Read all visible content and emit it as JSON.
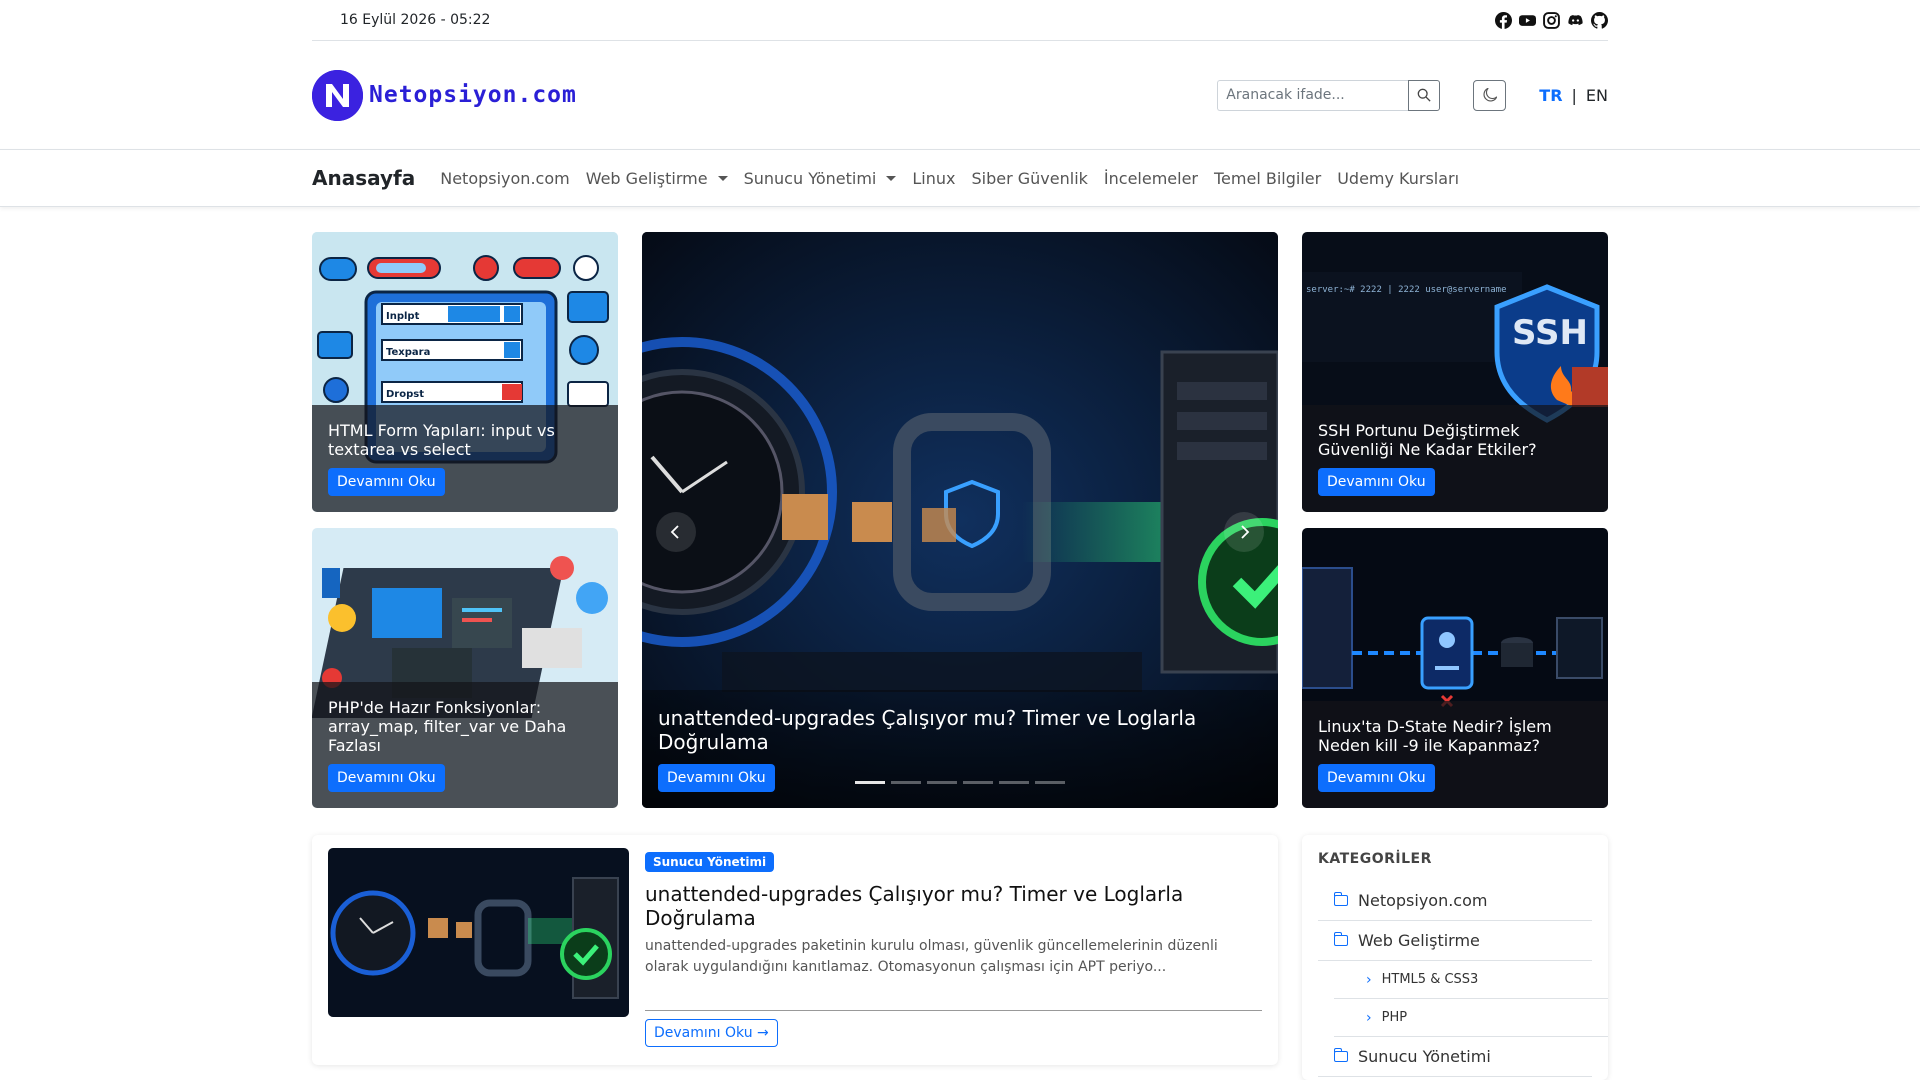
{
  "topbar": {
    "date": "16 Eylül 2026 - 05:22",
    "social": [
      "facebook-icon",
      "youtube-icon",
      "instagram-icon",
      "discord-icon",
      "github-icon"
    ]
  },
  "header": {
    "logo_text": "Netopsiyon.com",
    "search_placeholder": "Aranacak ifade...",
    "lang_active": "TR",
    "lang_sep": "|",
    "lang_other": "EN"
  },
  "nav": {
    "brand": "Anasayfa",
    "items": [
      {
        "label": "Netopsiyon.com",
        "dropdown": false
      },
      {
        "label": "Web Geliştirme",
        "dropdown": true
      },
      {
        "label": "Sunucu Yönetimi",
        "dropdown": true
      },
      {
        "label": "Linux",
        "dropdown": false
      },
      {
        "label": "Siber Güvenlik",
        "dropdown": false
      },
      {
        "label": "İncelemeler",
        "dropdown": false
      },
      {
        "label": "Temel Bilgiler",
        "dropdown": false
      },
      {
        "label": "Udemy Kursları",
        "dropdown": false
      }
    ]
  },
  "hero": {
    "left_top": {
      "title": "HTML Form Yapıları: input vs textarea vs select",
      "button": "Devamını Oku"
    },
    "left_bottom": {
      "title": "PHP'de Hazır Fonksiyonlar: array_map, filter_var ve Daha Fazlası",
      "button": "Devamını Oku"
    },
    "center": {
      "title": "unattended-upgrades Çalışıyor mu? Timer ve Loglarla Doğrulama",
      "button": "Devamını Oku"
    },
    "right_top": {
      "title": "SSH Portunu Değiştirmek Güvenliği Ne Kadar Etkiler?",
      "button": "Devamını Oku",
      "art_text": "SSH",
      "terminal": "server:~# 2222 | 2222 user@servername"
    },
    "right_bottom": {
      "title": "Linux'ta D-State Nedir? İşlem Neden kill -9 ile Kapanmaz?",
      "button": "Devamını Oku"
    },
    "form_art": {
      "f1": "Inplpt",
      "f2": "Texpara",
      "f3": "Dropst"
    }
  },
  "post": {
    "badge": "Sunucu Yönetimi",
    "title": "unattended-upgrades Çalışıyor mu? Timer ve Loglarla Doğrulama",
    "excerpt": "unattended-upgrades paketinin kurulu olması, güvenlik güncellemelerinin düzenli olarak uygulandığını kanıtlamaz. Otomasyonun çalışması için APT periyo...",
    "button": "Devamını Oku →"
  },
  "sidebar": {
    "heading": "KATEGORİLER",
    "categories": [
      {
        "label": "Netopsiyon.com",
        "level": 0
      },
      {
        "label": "Web Geliştirme",
        "level": 0
      },
      {
        "label": "HTML5 & CSS3",
        "level": 1
      },
      {
        "label": "PHP",
        "level": 1
      },
      {
        "label": "Sunucu Yönetimi",
        "level": 0
      }
    ]
  },
  "colors": {
    "brand": "#2a1fd6",
    "primary": "#0d6efd"
  }
}
